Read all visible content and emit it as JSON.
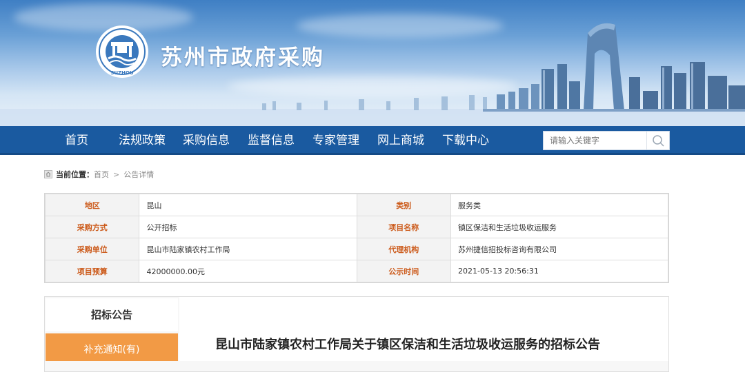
{
  "site": {
    "title": "苏州市政府采购",
    "logo_text": "SUZHOU"
  },
  "nav": {
    "items": [
      "首页",
      "法规政策",
      "采购信息",
      "监督信息",
      "专家管理",
      "网上商城",
      "下载中心"
    ],
    "search_placeholder": "请输入关键字"
  },
  "breadcrumb": {
    "label": "当前位置：",
    "home": "首页",
    "separator": ">",
    "current": "公告详情"
  },
  "info": {
    "rows": [
      {
        "l1": "地区",
        "v1": "昆山",
        "l2": "类别",
        "v2": "服务类"
      },
      {
        "l1": "采购方式",
        "v1": "公开招标",
        "l2": "项目名称",
        "v2": "镇区保洁和生活垃圾收运服务"
      },
      {
        "l1": "采购单位",
        "v1": "昆山市陆家镇农村工作局",
        "l2": "代理机构",
        "v2": "苏州捷信招投标咨询有限公司"
      },
      {
        "l1": "项目预算",
        "v1": "42000000.00元",
        "l2": "公示时间",
        "v2": "2021-05-13 20:56:31"
      }
    ]
  },
  "sidebar": {
    "tab1": "招标公告",
    "tab2": "补充通知(有)"
  },
  "notice": {
    "title": "昆山市陆家镇农村工作局关于镇区保洁和生活垃圾收运服务的招标公告"
  },
  "colors": {
    "nav_bg": "#1a5aa0",
    "label_text": "#cc5a1a",
    "active_tab": "#f29a45"
  }
}
